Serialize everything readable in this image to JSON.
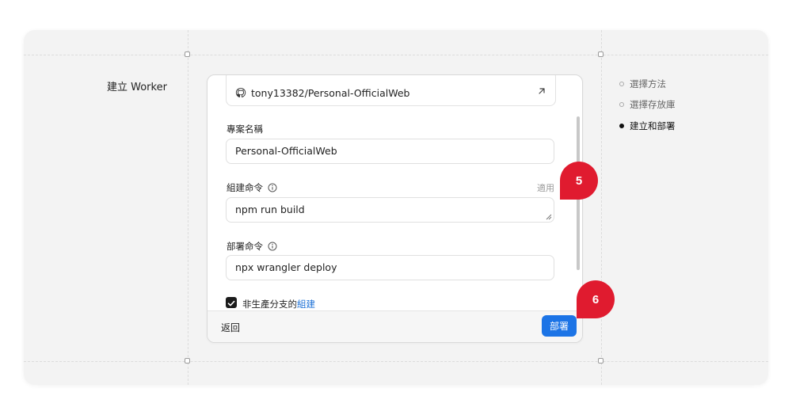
{
  "section": {
    "title": "建立 Worker"
  },
  "steps": [
    {
      "label": "選擇方法",
      "active": false
    },
    {
      "label": "選擇存放庫",
      "active": false
    },
    {
      "label": "建立和部署",
      "active": true
    }
  ],
  "repository": {
    "name": "tony13382/Personal-OfficialWeb"
  },
  "project_name": {
    "label": "專案名稱",
    "value": "Personal-OfficialWeb"
  },
  "build_command": {
    "label": "組建命令",
    "apply_label": "適用",
    "value": "npm run build"
  },
  "deploy_command": {
    "label": "部署命令",
    "value": "npx wrangler deploy"
  },
  "non_production": {
    "text": "非生產分支的",
    "link": "組建",
    "checked": true
  },
  "footer": {
    "back_label": "返回",
    "deploy_label": "部署"
  },
  "annotations": {
    "badge_5": "5",
    "badge_6": "6",
    "badge_color": "#e01b2f"
  },
  "colors": {
    "primary": "#1c74e6",
    "link": "#1a6fd6"
  }
}
